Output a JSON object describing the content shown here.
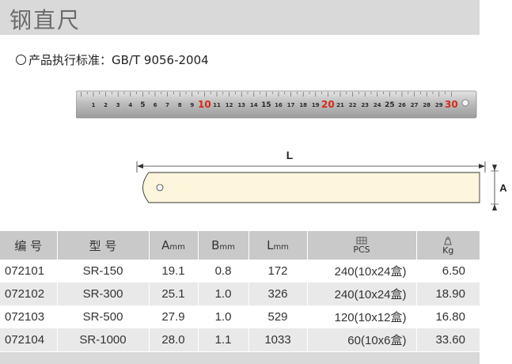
{
  "header": {
    "title": "钢直尺"
  },
  "standard": {
    "text": "产品执行标准：GB/T 9056-2004"
  },
  "ruler": {
    "ticks": [
      "1",
      "2",
      "3",
      "4",
      "5",
      "6",
      "7",
      "8",
      "9",
      "10",
      "11",
      "12",
      "13",
      "14",
      "15",
      "16",
      "17",
      "18",
      "19",
      "20",
      "21",
      "22",
      "23",
      "24",
      "25",
      "26",
      "27",
      "28",
      "29",
      "30"
    ],
    "highlight_ticks": [
      "10",
      "20",
      "30"
    ],
    "highlight_color": "#d42a1a"
  },
  "diagram": {
    "length_label": "L",
    "width_label": "A",
    "body_color": "#fdf5dc"
  },
  "table": {
    "headers": {
      "code": "编 号",
      "model": "型 号",
      "a_main": "A",
      "a_unit": "mm",
      "b_main": "B",
      "b_unit": "mm",
      "l_main": "L",
      "l_unit": "mm",
      "pcs": "PCS",
      "kg": "Kg"
    },
    "icons": {
      "pcs": "box-stack-icon",
      "kg": "weight-icon"
    },
    "rows": [
      {
        "code": "072101",
        "model": "SR-150",
        "a": "19.1",
        "b": "0.8",
        "l": "172",
        "pcs": "240(10x24盒)",
        "kg": "6.50"
      },
      {
        "code": "072102",
        "model": "SR-300",
        "a": "25.1",
        "b": "1.0",
        "l": "326",
        "pcs": "240(10x24盒)",
        "kg": "18.90"
      },
      {
        "code": "072103",
        "model": "SR-500",
        "a": "27.9",
        "b": "1.0",
        "l": "529",
        "pcs": "120(10x12盒)",
        "kg": "16.80"
      },
      {
        "code": "072104",
        "model": "SR-1000",
        "a": "28.0",
        "b": "1.1",
        "l": "1033",
        "pcs": "60(10x6盒)",
        "kg": "33.60"
      }
    ]
  }
}
